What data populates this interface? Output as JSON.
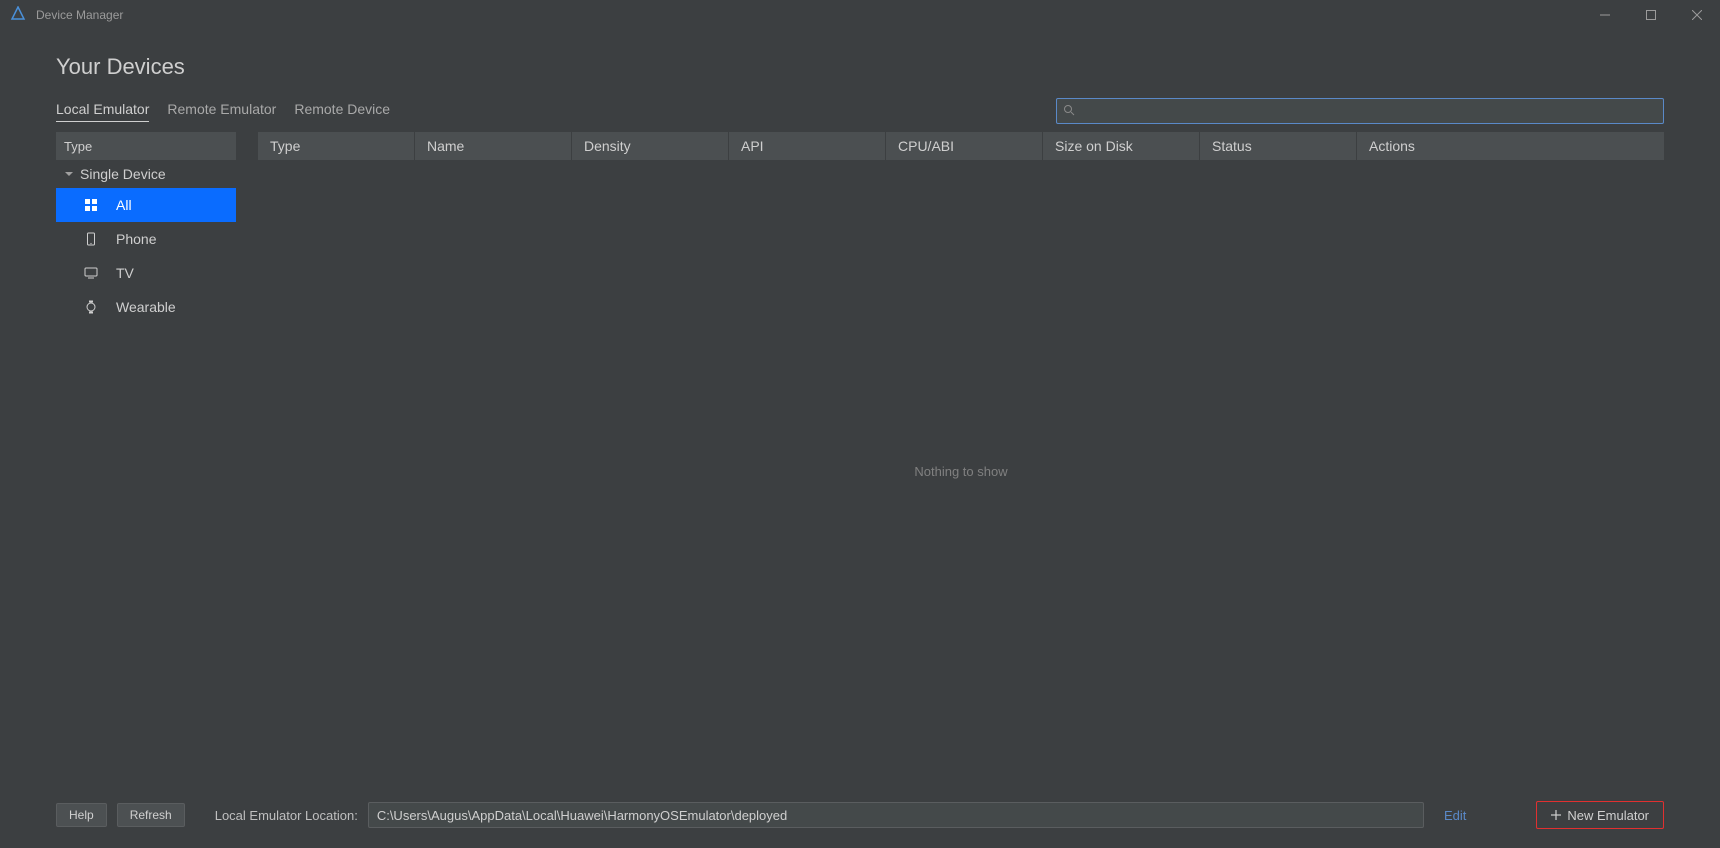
{
  "window": {
    "title": "Device Manager"
  },
  "page_title": "Your Devices",
  "tabs": [
    {
      "label": "Local Emulator",
      "active": true
    },
    {
      "label": "Remote Emulator",
      "active": false
    },
    {
      "label": "Remote Device",
      "active": false
    }
  ],
  "search": {
    "value": "",
    "placeholder": ""
  },
  "sidebar": {
    "header": "Type",
    "group_label": "Single Device",
    "items": [
      {
        "label": "All",
        "icon": "apps-icon",
        "selected": true
      },
      {
        "label": "Phone",
        "icon": "phone-icon",
        "selected": false
      },
      {
        "label": "TV",
        "icon": "tv-icon",
        "selected": false
      },
      {
        "label": "Wearable",
        "icon": "watch-icon",
        "selected": false
      }
    ]
  },
  "table": {
    "columns": [
      "Type",
      "Name",
      "Density",
      "API",
      "CPU/ABI",
      "Size on Disk",
      "Status",
      "Actions"
    ],
    "empty_text": "Nothing to show"
  },
  "footer": {
    "help_label": "Help",
    "refresh_label": "Refresh",
    "location_label": "Local Emulator Location:",
    "location_value": "C:\\Users\\Augus\\AppData\\Local\\Huawei\\HarmonyOSEmulator\\deployed",
    "edit_label": "Edit",
    "new_emulator_label": "New Emulator"
  }
}
